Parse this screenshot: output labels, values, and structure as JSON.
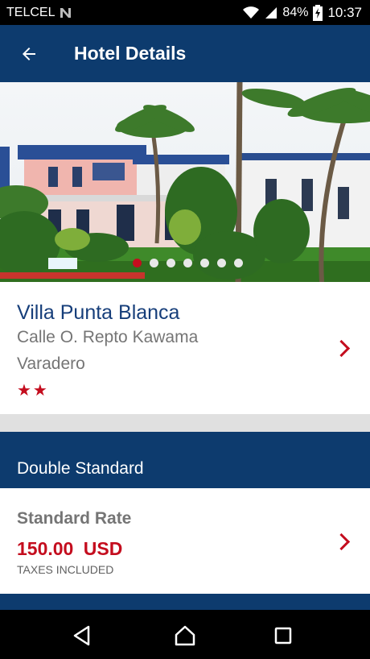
{
  "status_bar": {
    "carrier": "TELCEL",
    "battery": "84%",
    "time": "10:37"
  },
  "app_bar": {
    "title": "Hotel Details",
    "back_icon": "arrow-left-icon"
  },
  "gallery": {
    "image": "hotel-exterior-photo",
    "dot_count": 7,
    "active_dot": 1
  },
  "hotel": {
    "name": "Villa Punta Blanca",
    "address_line1": "Calle O. Repto  Kawama",
    "address_line2": "Varadero",
    "rating_stars": 2,
    "stars_text": "★★"
  },
  "room": {
    "type": "Double Standard"
  },
  "rate": {
    "title": "Standard Rate",
    "price": "150.00  USD",
    "note": "TAXES INCLUDED"
  },
  "colors": {
    "primary": "#0d3b6e",
    "accent": "#c40d1e",
    "hotel_name": "#163e7a"
  }
}
